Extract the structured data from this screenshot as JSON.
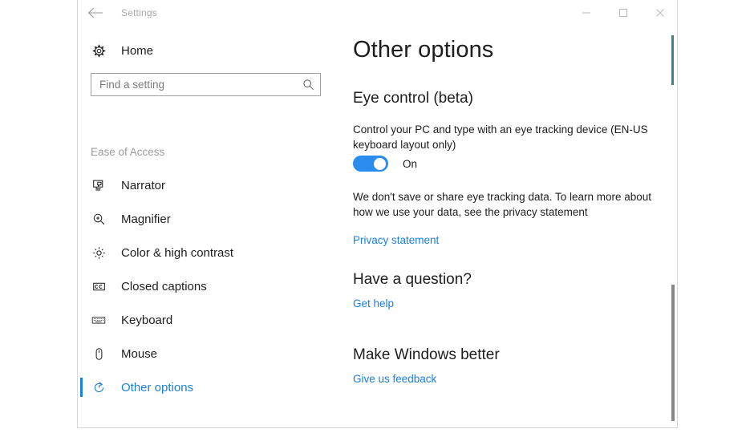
{
  "window": {
    "title": "Settings",
    "back_icon": "back-arrow-icon",
    "minimize_label": "Minimize",
    "maximize_label": "Maximize",
    "close_label": "Close"
  },
  "sidebar": {
    "home": {
      "label": "Home",
      "icon": "gear-icon"
    },
    "search": {
      "placeholder": "Find a setting",
      "value": "",
      "icon": "search-icon"
    },
    "group_label": "Ease of Access",
    "items": [
      {
        "label": "Narrator",
        "icon": "narrator-icon",
        "selected": false
      },
      {
        "label": "Magnifier",
        "icon": "magnifier-icon",
        "selected": false
      },
      {
        "label": "Color & high contrast",
        "icon": "brightness-icon",
        "selected": false
      },
      {
        "label": "Closed captions",
        "icon": "closed-captions-icon",
        "selected": false
      },
      {
        "label": "Keyboard",
        "icon": "keyboard-icon",
        "selected": false
      },
      {
        "label": "Mouse",
        "icon": "mouse-icon",
        "selected": false
      },
      {
        "label": "Other options",
        "icon": "refresh-circle-icon",
        "selected": true
      }
    ]
  },
  "main": {
    "page_title": "Other options",
    "eye_control": {
      "heading": "Eye control (beta)",
      "description": "Control your PC and type with an eye tracking device (EN-US keyboard layout only)",
      "toggle_state": "On",
      "toggle_on": true,
      "privacy_text": "We don't save or share eye tracking data. To learn more about how we use your data, see the privacy statement",
      "privacy_link": "Privacy statement"
    },
    "question": {
      "heading": "Have a question?",
      "link": "Get help"
    },
    "feedback": {
      "heading": "Make Windows better",
      "link": "Give us feedback"
    }
  },
  "colors": {
    "accent": "#1b7fe0",
    "toggle_on": "#2b8cf0",
    "text": "#1d1d1d",
    "muted": "#9b9b9b"
  }
}
